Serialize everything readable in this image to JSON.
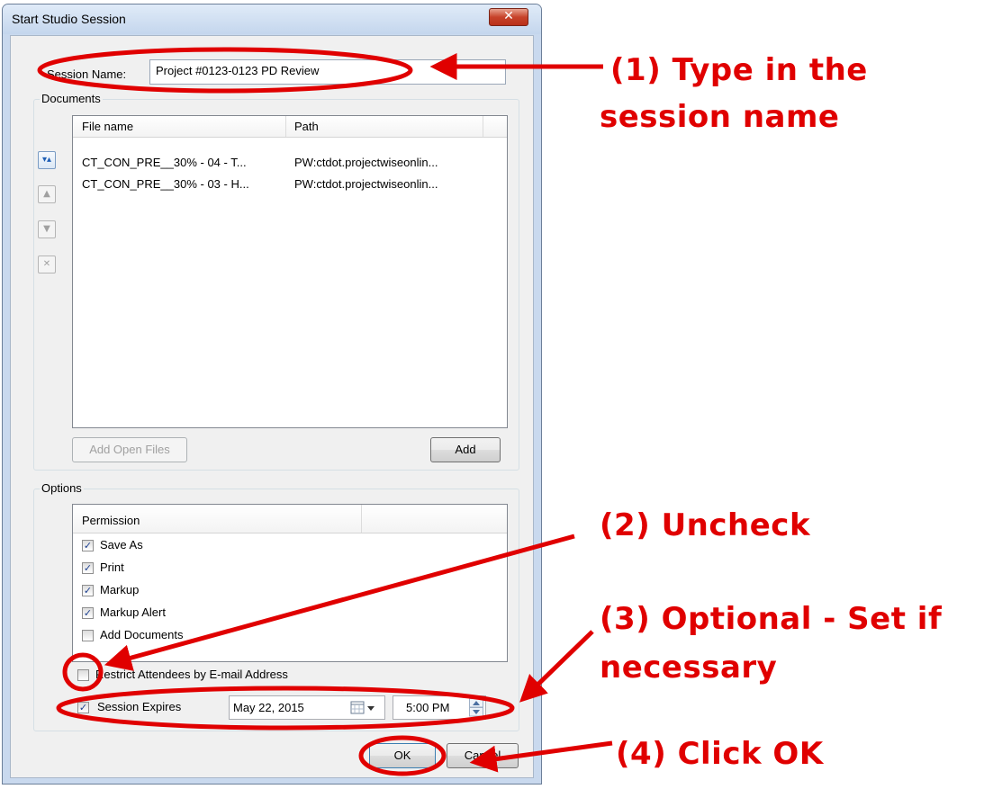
{
  "window": {
    "title": "Start Studio Session",
    "close_icon": "close-icon",
    "close_glyph": "✕"
  },
  "session": {
    "label": "Session Name:",
    "value": "Project #0123-0123 PD Review"
  },
  "documents": {
    "group_label": "Documents",
    "columns": [
      "File name",
      "Path"
    ],
    "rows": [
      {
        "file": "CT_CON_PRE__30% - 04 - T...",
        "path": "PW:ctdot.projectwiseonlin..."
      },
      {
        "file": "CT_CON_PRE__30% - 03 - H...",
        "path": "PW:ctdot.projectwiseonlin..."
      }
    ],
    "side_buttons": {
      "move_top_glyph": "▾▴",
      "move_up_glyph": "▲",
      "move_down_glyph": "▼",
      "remove_glyph": "✕"
    },
    "add_open_files_label": "Add Open Files",
    "add_label": "Add"
  },
  "options": {
    "group_label": "Options",
    "permission_header": "Permission",
    "permissions": [
      {
        "label": "Save As",
        "checked": true
      },
      {
        "label": "Print",
        "checked": true
      },
      {
        "label": "Markup",
        "checked": true
      },
      {
        "label": "Markup Alert",
        "checked": true
      },
      {
        "label": "Add Documents",
        "checked": false
      }
    ],
    "restrict_label": "Restrict Attendees by E-mail Address",
    "restrict_checked": false,
    "expires_label": "Session Expires",
    "expires_checked": true,
    "date_value": "May 22, 2015",
    "time_value": "5:00 PM"
  },
  "buttons": {
    "ok_label": "OK",
    "cancel_label": "Cancel"
  },
  "annotations": {
    "step1_line1": "(1) Type in the",
    "step1_line2": "session name",
    "step2": "(2) Uncheck",
    "step3_line1": "(3) Optional - Set if",
    "step3_line2": "necessary",
    "step4": "(4) Click OK",
    "color": "#e00000"
  },
  "check_glyph": "✓"
}
